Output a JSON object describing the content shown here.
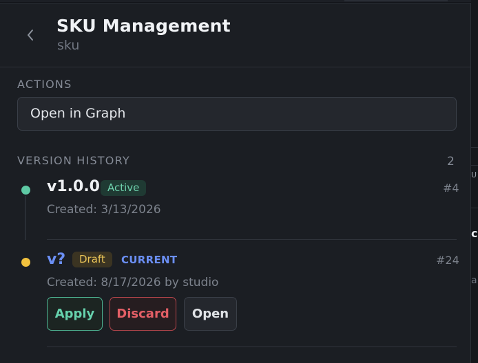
{
  "header": {
    "title": "SKU Management",
    "subtitle": "sku"
  },
  "actions": {
    "label": "ACTIONS",
    "open_graph_label": "Open in Graph"
  },
  "version_history": {
    "label": "VERSION HISTORY",
    "count": "2",
    "versions": [
      {
        "name": "v1.0.0",
        "status": "Active",
        "number": "#4",
        "created": "Created: 3/13/2026",
        "status_color": "#5ec9a4"
      },
      {
        "name": "v?",
        "status": "Draft",
        "current_tag": "CURRENT",
        "number": "#24",
        "created": "Created: 8/17/2026 by studio",
        "status_color": "#f2c23e",
        "buttons": {
          "apply": "Apply",
          "discard": "Discard",
          "open": "Open"
        }
      }
    ]
  },
  "background": {
    "right_snippet_1": "U",
    "right_snippet_2": "c",
    "right_snippet_3": "a"
  },
  "colors": {
    "panel_bg": "#1b1e23",
    "accent_blue": "#6b8ff5",
    "active_green": "#5ec9a4",
    "draft_yellow": "#f2c23e",
    "discard_red": "#e35f66"
  }
}
